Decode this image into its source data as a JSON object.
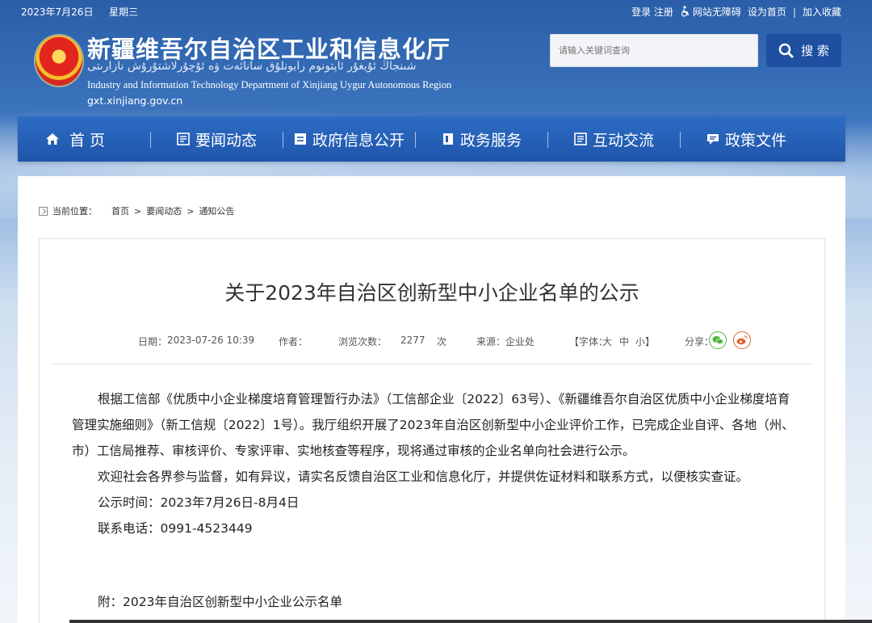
{
  "topbar": {
    "date": "2023年7月26日",
    "weekday": "星期三",
    "login_register": "登录 注册",
    "accessibility": "网站无障碍",
    "set_homepage": "设为首页",
    "separator": "|",
    "bookmark": "加入收藏"
  },
  "header": {
    "title": "新疆维吾尔自治区工业和信息化厅",
    "title_uyghur": "شىنجاڭ ئۇيغۇر ئاپتونوم رايونلۇق سانائەت ۋە ئۇچۇرلاشتۇرۇش نازارىتى",
    "title_en": "Industry and Information Technology Department of Xinjiang Uygur Autonomous Region",
    "domain": "gxt.xinjiang.gov.cn"
  },
  "search": {
    "placeholder": "请输入关键词查询",
    "button_label": "搜 索"
  },
  "nav": {
    "items": [
      {
        "label": "首 页",
        "icon": "home-icon"
      },
      {
        "label": "要闻动态",
        "icon": "news-icon"
      },
      {
        "label": "政府信息公开",
        "icon": "info-icon"
      },
      {
        "label": "政务服务",
        "icon": "service-icon"
      },
      {
        "label": "互动交流",
        "icon": "interact-icon"
      },
      {
        "label": "政策文件",
        "icon": "policy-icon"
      }
    ]
  },
  "breadcrumb": {
    "label": "当前位置：",
    "items": [
      "首页",
      "要闻动态",
      "通知公告"
    ],
    "separator": ">"
  },
  "article": {
    "title": "关于2023年自治区创新型中小企业名单的公示",
    "meta": {
      "date_label": "日期：",
      "date": "2023-07-26 10:39",
      "author_label": "作者：",
      "views_label": "浏览次数：",
      "views": "2277",
      "views_unit": "次",
      "source_label": "来源：",
      "source": "企业处",
      "font_label": "【字体：",
      "font_large": "大",
      "font_medium": "中",
      "font_small": "小】",
      "share_label": "分享："
    },
    "paragraphs": [
      "根据工信部《优质中小企业梯度培育管理暂行办法》（工信部企业〔2022〕63号）、《新疆维吾尔自治区优质中小企业梯度培育管理实施细则》（新工信规〔2022〕1号）。我厅组织开展了2023年自治区创新型中小企业评价工作，已完成企业自评、各地（州、市）工信局推荐、审核评价、专家评审、实地核查等程序，现将通过审核的企业名单向社会进行公示。",
      "欢迎社会各界参与监督，如有异议，请实名反馈自治区工业和信息化厅，并提供佐证材料和联系方式，以便核实查证。",
      "公示时间：2023年7月26日-8月4日",
      "联系电话：0991-4523449"
    ],
    "annex": "附：2023年自治区创新型中小企业公示名单"
  },
  "colors": {
    "nav_bg": "#2d6cc4",
    "search_btn": "#1e4fa0",
    "wechat": "#4db83b",
    "weibo": "#e2602b"
  }
}
